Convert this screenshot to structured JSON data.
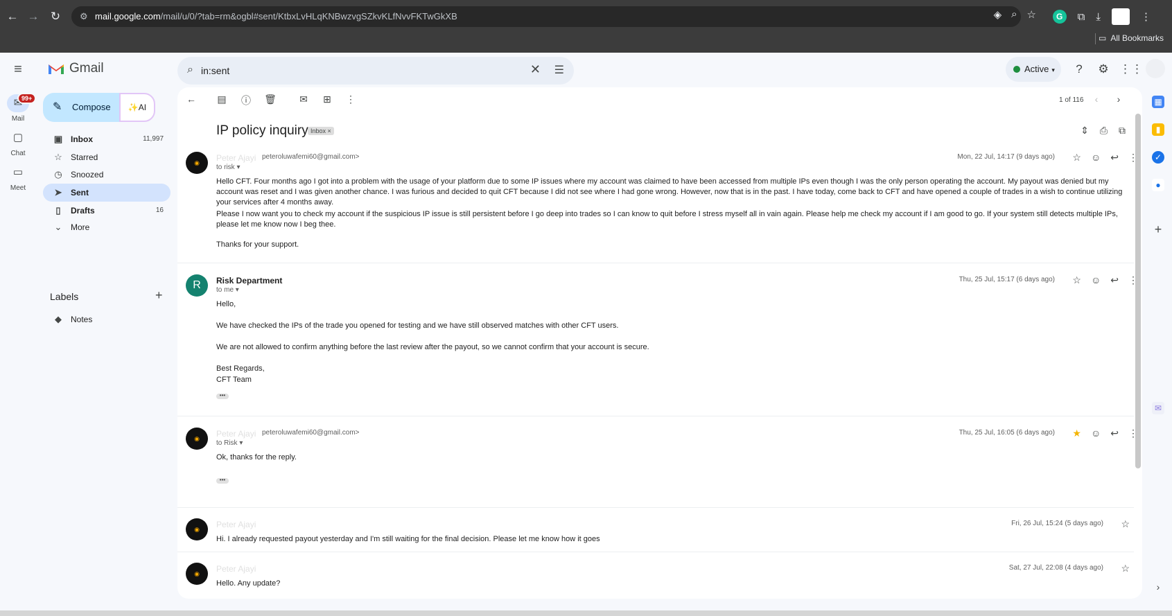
{
  "browser": {
    "url_host": "mail.google.com",
    "url_path": "/mail/u/0/?tab=rm&ogbl#sent/KtbxLvHLqKNBwzvgSZkvKLfNvvFKTwGkXB",
    "bookmarks_label": "All Bookmarks"
  },
  "app": {
    "logo_text": "Gmail",
    "search_value": "in:sent",
    "status_label": "Active"
  },
  "rail": [
    {
      "label": "Mail",
      "badge": "99+"
    },
    {
      "label": "Chat"
    },
    {
      "label": "Meet"
    }
  ],
  "sidebar": {
    "compose_label": "Compose",
    "ai_label": "✨AI",
    "items": [
      {
        "label": "Inbox",
        "count": "11,997"
      },
      {
        "label": "Starred"
      },
      {
        "label": "Snoozed"
      },
      {
        "label": "Sent"
      },
      {
        "label": "Drafts",
        "count": "16"
      },
      {
        "label": "More"
      }
    ],
    "labels_title": "Labels",
    "labels": [
      {
        "label": "Notes"
      }
    ]
  },
  "thread": {
    "pager": "1 of 116",
    "subject": "IP policy inquiry",
    "chip": "Inbox ×",
    "messages": [
      {
        "sender": "Peter Ajayi",
        "email": "peteroluwafemi60@gmail.com>",
        "recipient": "to risk",
        "date": "Mon, 22 Jul, 14:17 (9 days ago)",
        "paragraphs": [
          "Hello CFT. Four months ago I got into a problem with the usage of your platform due to some IP issues where my account was claimed to have been accessed from multiple IPs even though I was the only person operating the account. My payout was denied but my account was reset and I was given another chance. I was furious and decided to quit CFT because I did not see where I had gone wrong. However, now that is in the past. I have today, come back to CFT and have opened a couple of trades in a wish to continue utilizing your services after 4 months away.",
          "Please I now want you to check my account if the suspicious IP issue is still persistent before I go deep into trades so I can know to quit before I stress myself all in vain again. Please help me check my account if I am good to go. If your system still detects multiple IPs, please let me know now I beg thee.",
          "Thanks for your support."
        ]
      },
      {
        "sender": "Risk Department",
        "initial": "R",
        "recipient": "to me",
        "date": "Thu, 25 Jul, 15:17 (6 days ago)",
        "paragraphs": [
          "Hello,",
          "We have checked the IPs of the trade you opened for testing and we have still observed matches with other CFT users.",
          "We are not allowed to confirm anything before the last review after the payout, so we cannot confirm that your account is secure.",
          "Best Regards,",
          "CFT Team"
        ]
      },
      {
        "sender": "Peter Ajayi",
        "email": "peteroluwafemi60@gmail.com>",
        "recipient": "to Risk",
        "date": "Thu, 25 Jul, 16:05 (6 days ago)",
        "paragraphs": [
          "Ok, thanks for the reply."
        ]
      },
      {
        "sender": "Peter Ajayi",
        "date": "Fri, 26 Jul, 15:24 (5 days ago)",
        "snippet": "Hi. I already requested payout yesterday and I'm still waiting for the final decision. Please let me know how it goes"
      },
      {
        "sender": "Peter Ajayi",
        "date": "Sat, 27 Jul, 22:08 (4 days ago)",
        "snippet": "Hello. Any update?"
      }
    ]
  },
  "colors": {
    "accent": "#0b57d0",
    "compose_bg": "#c2e7ff",
    "active_nav": "#d3e3fd",
    "star": "#f4b400"
  }
}
